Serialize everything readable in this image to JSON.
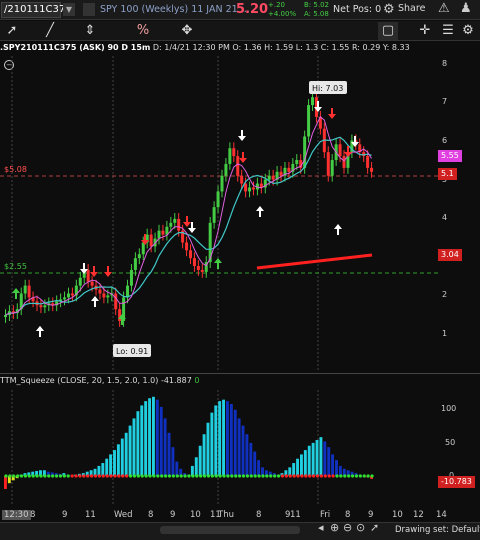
{
  "topbar": {
    "symbol": "/210111C375",
    "description": "SPY 100 (Weeklys) 11 JAN 21 ...",
    "last_price": "5.20",
    "change_a": "+.20",
    "change_b": "+4.00%",
    "bid": "B: 5.02",
    "ask": "A: 5.08",
    "net_pos": "Net Pos: 0",
    "share_label": "Share"
  },
  "toolbar": {
    "icons": [
      "cursor-icon",
      "pencil-icon",
      "price-tool-icon",
      "percent-icon",
      "crosshair-icon",
      "gear-icon"
    ]
  },
  "chart": {
    "header": ".SPY210111C375 (ASK) 90 D 15m",
    "date": "D: 1/4/21 12:30 PM",
    "open": "O: 1.36",
    "high": "H: 1.59",
    "low": "L: 1.3",
    "close": "C: 1.55",
    "range": "R: 0.29",
    "y": "Y: 8.33",
    "hi_label": "Hi: 7.03",
    "lo_label": "Lo: 0.91",
    "line_508": "$5.08",
    "line_255": "$2.55",
    "price_axis": [
      "8",
      "7",
      "6",
      "5",
      "4",
      "3",
      "2",
      "1"
    ],
    "badge_555": "5.55",
    "badge_51": "5.1",
    "badge_304": "3.04",
    "colors": {
      "up": "#44cc44",
      "down": "#ff3030",
      "fast_ma": "#e060e0",
      "slow_ma": "#40c8c8"
    }
  },
  "indicator": {
    "title": "TTM_Squeeze (CLOSE, 20, 1.5, 2.0, 1.0)",
    "value": "-41.887",
    "zero": "0",
    "axis": [
      "100",
      "50",
      "0"
    ],
    "badge": "-10.783"
  },
  "x_axis": [
    "12:30",
    "8",
    "9",
    "11",
    "Wed",
    "8",
    "9",
    "10",
    "11",
    "Thu",
    "8",
    "9",
    "11",
    "Fri",
    "8",
    "9",
    "10",
    "12",
    "14"
  ],
  "bottom": {
    "drawing_set": "Drawing set: Default"
  }
}
